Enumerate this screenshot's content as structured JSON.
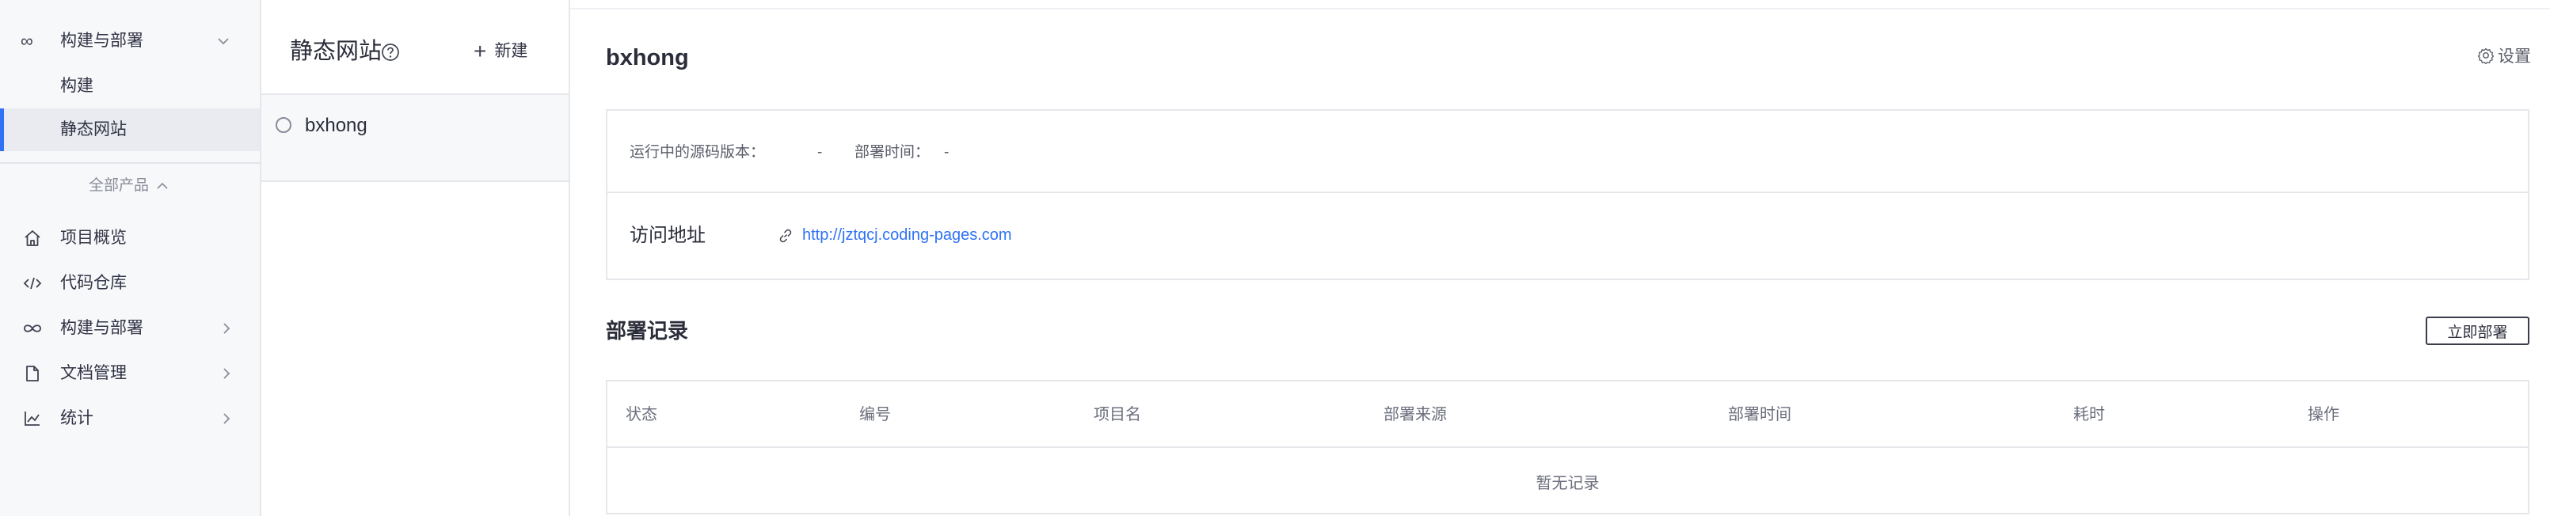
{
  "sidebar": {
    "group": {
      "label": "构建与部署"
    },
    "sub_items": [
      {
        "label": "构建"
      },
      {
        "label": "静态网站",
        "active": true
      }
    ],
    "all_products": {
      "label": "全部产品"
    },
    "items": [
      {
        "label": "项目概览",
        "icon": "home-icon"
      },
      {
        "label": "代码仓库",
        "icon": "code-icon"
      },
      {
        "label": "构建与部署",
        "icon": "infinity-icon"
      },
      {
        "label": "文档管理",
        "icon": "document-icon"
      },
      {
        "label": "统计",
        "icon": "chart-icon"
      }
    ],
    "accent_color": "#2f72f5"
  },
  "list_pane": {
    "title": "静态网站",
    "new_label": "新建",
    "sites": [
      {
        "name": "bxhong"
      }
    ]
  },
  "detail": {
    "site_name": "bxhong",
    "settings_label": "设置",
    "running_version_label": "运行中的源码版本：",
    "running_version_value": "-",
    "deploy_time_label": "部署时间：",
    "deploy_time_value": "-",
    "access_label": "访问地址",
    "access_url": "http://jztqcj.coding-pages.com",
    "records_title": "部署记录",
    "deploy_now_label": "立即部署",
    "table_columns": [
      "状态",
      "编号",
      "项目名",
      "部署来源",
      "部署时间",
      "耗时",
      "操作"
    ],
    "empty_text": "暂无记录"
  }
}
